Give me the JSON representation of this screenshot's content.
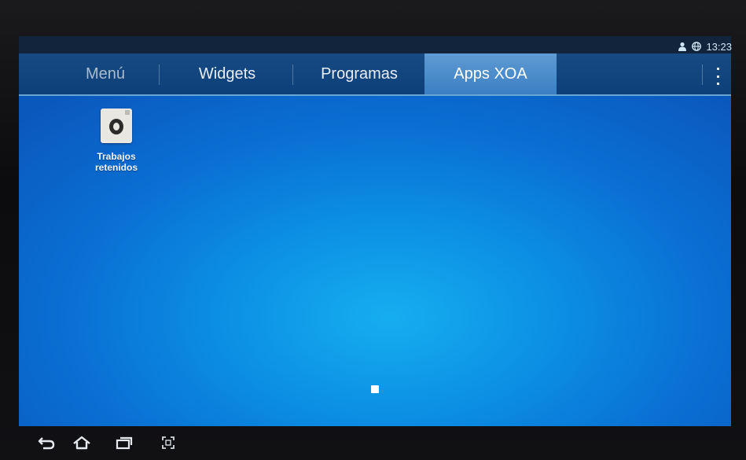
{
  "status": {
    "time": "13:23",
    "icons": [
      "person-icon",
      "globe-icon"
    ]
  },
  "tabs": [
    {
      "label": "Menú",
      "active": false
    },
    {
      "label": "Widgets",
      "active": false
    },
    {
      "label": "Programas",
      "active": false
    },
    {
      "label": "Apps XOA",
      "active": true
    }
  ],
  "menu_icon": "overflow-menu-icon",
  "apps": [
    {
      "label": "Trabajos\nretenidos",
      "icon": "held-jobs-icon"
    }
  ],
  "nav": [
    "back-icon",
    "home-icon",
    "recent-apps-icon",
    "screenshot-icon"
  ],
  "colors": {
    "active_tab": "#4a8ccb",
    "screen_blue": "#0b8ee3"
  }
}
